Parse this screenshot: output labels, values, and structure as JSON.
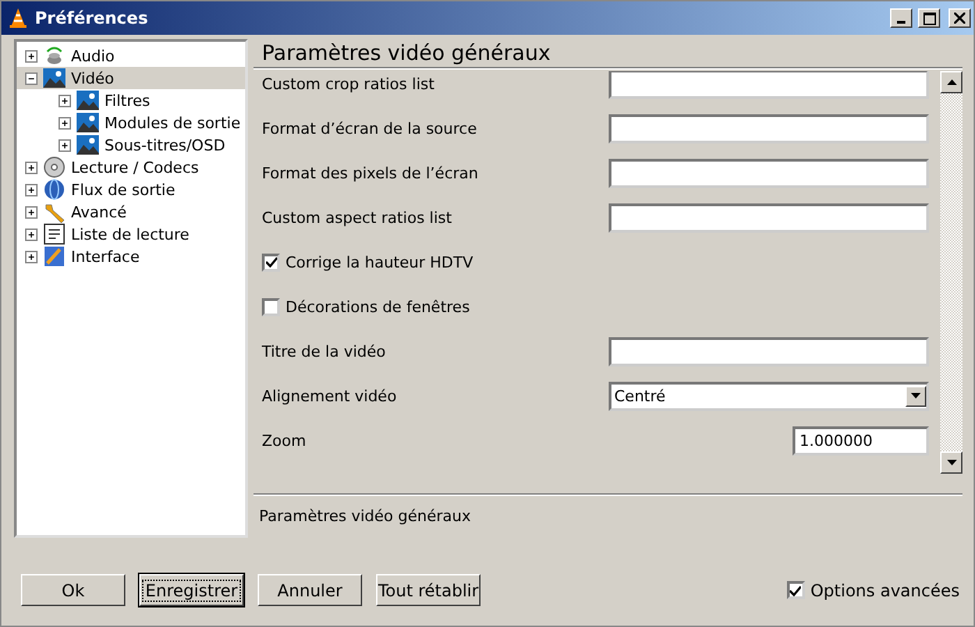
{
  "window": {
    "title": "Préférences"
  },
  "tree": [
    {
      "label": "Audio",
      "expanded": false,
      "selected": false
    },
    {
      "label": "Vidéo",
      "expanded": true,
      "selected": true,
      "children": [
        {
          "label": "Filtres",
          "expanded": false,
          "selected": false
        },
        {
          "label": "Modules de sortie",
          "expanded": false,
          "selected": false
        },
        {
          "label": "Sous-titres/OSD",
          "expanded": false,
          "selected": false
        }
      ]
    },
    {
      "label": "Lecture / Codecs",
      "expanded": false,
      "selected": false
    },
    {
      "label": "Flux de sortie",
      "expanded": false,
      "selected": false
    },
    {
      "label": "Avancé",
      "expanded": false,
      "selected": false
    },
    {
      "label": "Liste de lecture",
      "expanded": false,
      "selected": false
    },
    {
      "label": "Interface",
      "expanded": false,
      "selected": false
    }
  ],
  "panel": {
    "title": "Paramètres vidéo généraux",
    "settings": [
      {
        "kind": "text",
        "label": "Custom crop ratios list"
      },
      {
        "kind": "text",
        "label": "Format d’écran de la source"
      },
      {
        "kind": "text",
        "label": "Format des pixels de l’écran"
      },
      {
        "kind": "text",
        "label": "Custom aspect ratios list"
      },
      {
        "kind": "checkbox",
        "label": "Corrige la hauteur HDTV",
        "checked": true
      },
      {
        "kind": "checkbox",
        "label": "Décorations de fenêtres",
        "checked": false
      },
      {
        "kind": "text",
        "label": "Titre de la vidéo"
      },
      {
        "kind": "dropdown",
        "label": "Alignement vidéo",
        "value": "Centré"
      },
      {
        "kind": "number",
        "label": "Zoom",
        "value": "1.000000"
      }
    ],
    "description": "Paramètres vidéo généraux"
  },
  "buttons": [
    {
      "label": "Ok",
      "focused": false
    },
    {
      "label": "Enregistrer",
      "focused": true
    },
    {
      "label": "Annuler",
      "focused": false
    },
    {
      "label": "Tout rétablir",
      "focused": false
    }
  ],
  "advanced_options": {
    "label": "Options avancées",
    "checked": true
  }
}
